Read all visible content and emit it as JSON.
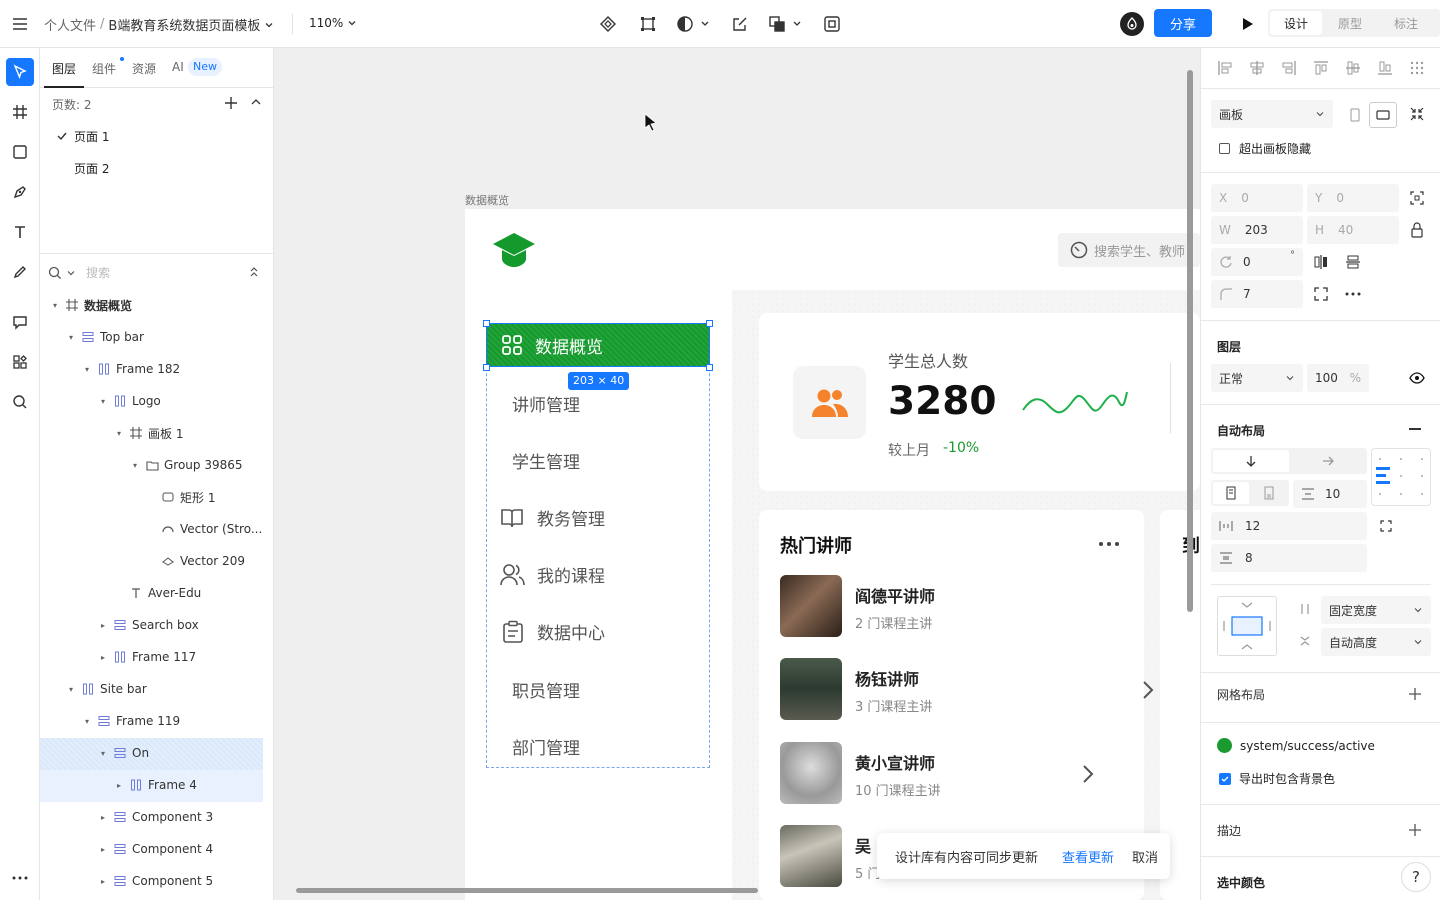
{
  "topbar": {
    "breadcrumb_root": "个人文件",
    "breadcrumb_sep": "/",
    "file_name": "B端教育系统数据页面模板",
    "zoom": "110%",
    "share_label": "分享",
    "mode_tabs": [
      "设计",
      "原型",
      "标注"
    ]
  },
  "left_panel": {
    "tabs": [
      "图层",
      "组件",
      "资源",
      "AI"
    ],
    "ai_badge": "New",
    "pages_label": "页数: 2",
    "pages": [
      "页面 1",
      "页面 2"
    ],
    "search_placeholder": "搜索",
    "layers": [
      {
        "name": "数据概览",
        "indent": 0
      },
      {
        "name": "Top bar",
        "indent": 1
      },
      {
        "name": "Frame 182",
        "indent": 2
      },
      {
        "name": "Logo",
        "indent": 3
      },
      {
        "name": "画板 1",
        "indent": 4
      },
      {
        "name": "Group 39865",
        "indent": 5
      },
      {
        "name": "矩形 1",
        "indent": 6
      },
      {
        "name": "Vector (Stro...",
        "indent": 6
      },
      {
        "name": "Vector 209",
        "indent": 6
      },
      {
        "name": "Aver-Edu",
        "indent": 4
      },
      {
        "name": "Search box",
        "indent": 3
      },
      {
        "name": "Frame 117",
        "indent": 3
      },
      {
        "name": "Site bar",
        "indent": 1
      },
      {
        "name": "Frame 119",
        "indent": 2
      },
      {
        "name": "On",
        "indent": 3
      },
      {
        "name": "Frame 4",
        "indent": 4
      },
      {
        "name": "Component 3",
        "indent": 3
      },
      {
        "name": "Component 4",
        "indent": 3
      },
      {
        "name": "Component 5",
        "indent": 3
      }
    ]
  },
  "canvas": {
    "frame_label": "数据概览",
    "search_placeholder": "搜索学生、教师",
    "selection_size": "203 × 40",
    "nav": [
      "数据概览",
      "讲师管理",
      "学生管理",
      "教务管理",
      "我的课程",
      "数据中心",
      "职员管理",
      "部门管理"
    ],
    "stat": {
      "title": "学生总人数",
      "value": "3280",
      "compare_label": "较上月",
      "compare_value": "-10%"
    },
    "teachers_title": "热门讲师",
    "teachers": [
      {
        "name": "阎德平讲师",
        "sub": "2 门课程主讲"
      },
      {
        "name": "杨钰讲师",
        "sub": "3 门课程主讲"
      },
      {
        "name": "黄小宣讲师",
        "sub": "10 门课程主讲"
      },
      {
        "name": "吴",
        "sub": "5 门"
      }
    ],
    "right_card_title_partial": "到",
    "toast": {
      "message": "设计库有内容可同步更新",
      "action": "查看更新",
      "cancel": "取消"
    }
  },
  "right_panel": {
    "frame_type": "画板",
    "clip_label": "超出画板隐藏",
    "x": "0",
    "y": "0",
    "w": "203",
    "h": "40",
    "rotation": "0",
    "rotation_unit": "°",
    "radius": "7",
    "labels": {
      "x": "X",
      "y": "Y",
      "w": "W",
      "h": "H"
    },
    "layer_section": "图层",
    "blend_mode": "正常",
    "opacity": "100",
    "opacity_unit": "%",
    "auto_layout": "自动布局",
    "gap": "10",
    "padding_h": "12",
    "padding_v": "8",
    "width_mode": "固定宽度",
    "height_mode": "自动高度",
    "grid_layout": "网格布局",
    "fill_name": "system/success/active",
    "fill_color": "#1a9a2f",
    "export_bg_label": "导出时包含背景色",
    "stroke_label": "描边",
    "selected_colors": "选中颜色"
  },
  "colors": {
    "accent": "#1677ff",
    "brand_green": "#149a2c",
    "orange": "#f5832c"
  }
}
